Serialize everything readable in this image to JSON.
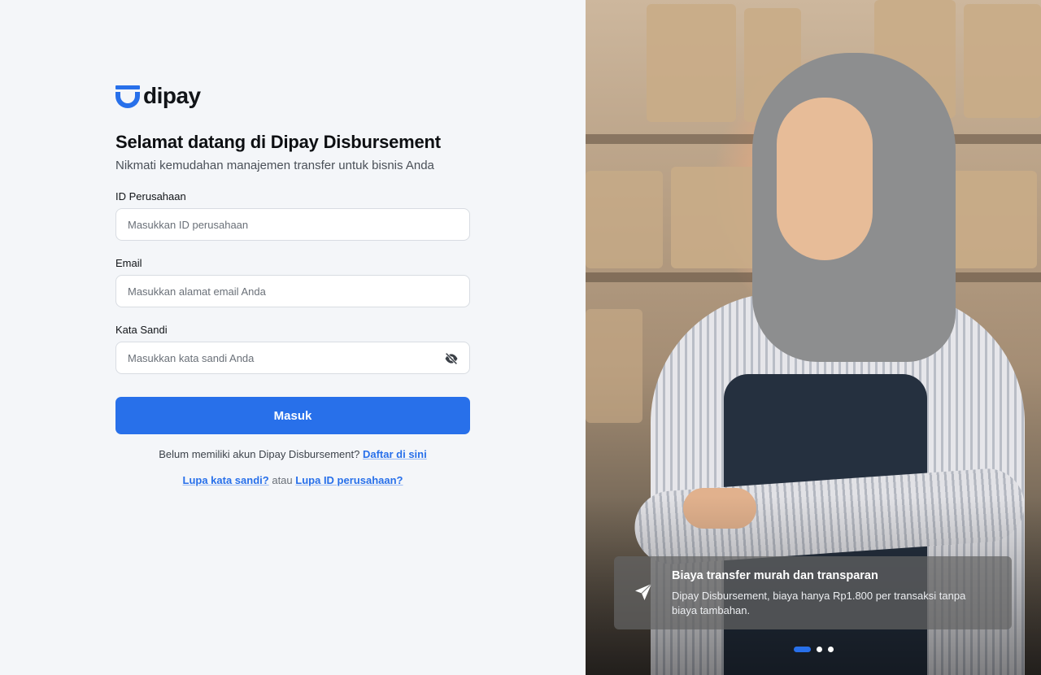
{
  "brand": {
    "name": "dipay",
    "color": "#2870ea"
  },
  "heading": {
    "title": "Selamat datang di Dipay Disbursement",
    "subtitle": "Nikmati kemudahan manajemen transfer untuk bisnis Anda"
  },
  "form": {
    "company_id": {
      "label": "ID Perusahaan",
      "placeholder": "Masukkan ID perusahaan",
      "value": ""
    },
    "email": {
      "label": "Email",
      "placeholder": "Masukkan alamat email Anda",
      "value": ""
    },
    "password": {
      "label": "Kata Sandi",
      "placeholder": "Masukkan kata sandi Anda",
      "value": "",
      "toggle_icon": "eye-off-icon"
    },
    "submit_label": "Masuk"
  },
  "signup": {
    "prompt": "Belum memiliki akun Dipay Disbursement?",
    "link": "Daftar di sini"
  },
  "forgot": {
    "password_link": "Lupa kata sandi?",
    "separator": "atau",
    "company_id_link": "Lupa ID perusahaan?"
  },
  "carousel": {
    "icon": "send-icon",
    "title": "Biaya transfer murah dan transparan",
    "description": "Dipay Disbursement, biaya hanya Rp1.800 per transaksi tanpa biaya tambahan.",
    "total_slides": 3,
    "active_slide": 1
  }
}
